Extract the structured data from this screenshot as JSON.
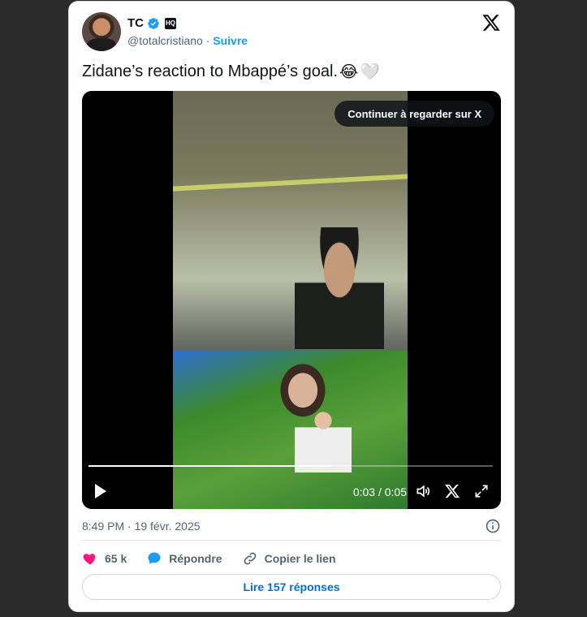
{
  "user": {
    "display_name": "TC",
    "handle": "@totalcristiano",
    "separator": "·",
    "follow_label": "Suivre",
    "badge_text": "HQ"
  },
  "tweet": {
    "text": "Zidane’s reaction to Mbappé’s goal.",
    "emoji_1": "😂",
    "emoji_2": "🤍",
    "timestamp": "8:49 PM · 19 févr. 2025"
  },
  "video": {
    "continue_label": "Continuer à regarder sur X",
    "current_time": "0:03",
    "time_sep": " / ",
    "duration": "0:05",
    "progress_fraction": 0.6
  },
  "actions": {
    "likes": "65 k",
    "reply_label": "Répondre",
    "copy_label": "Copier le lien"
  },
  "replies_button": "Lire 157 réponses",
  "colors": {
    "accent": "#1d9bf0",
    "like": "#f91880",
    "link": "#006fd6"
  }
}
